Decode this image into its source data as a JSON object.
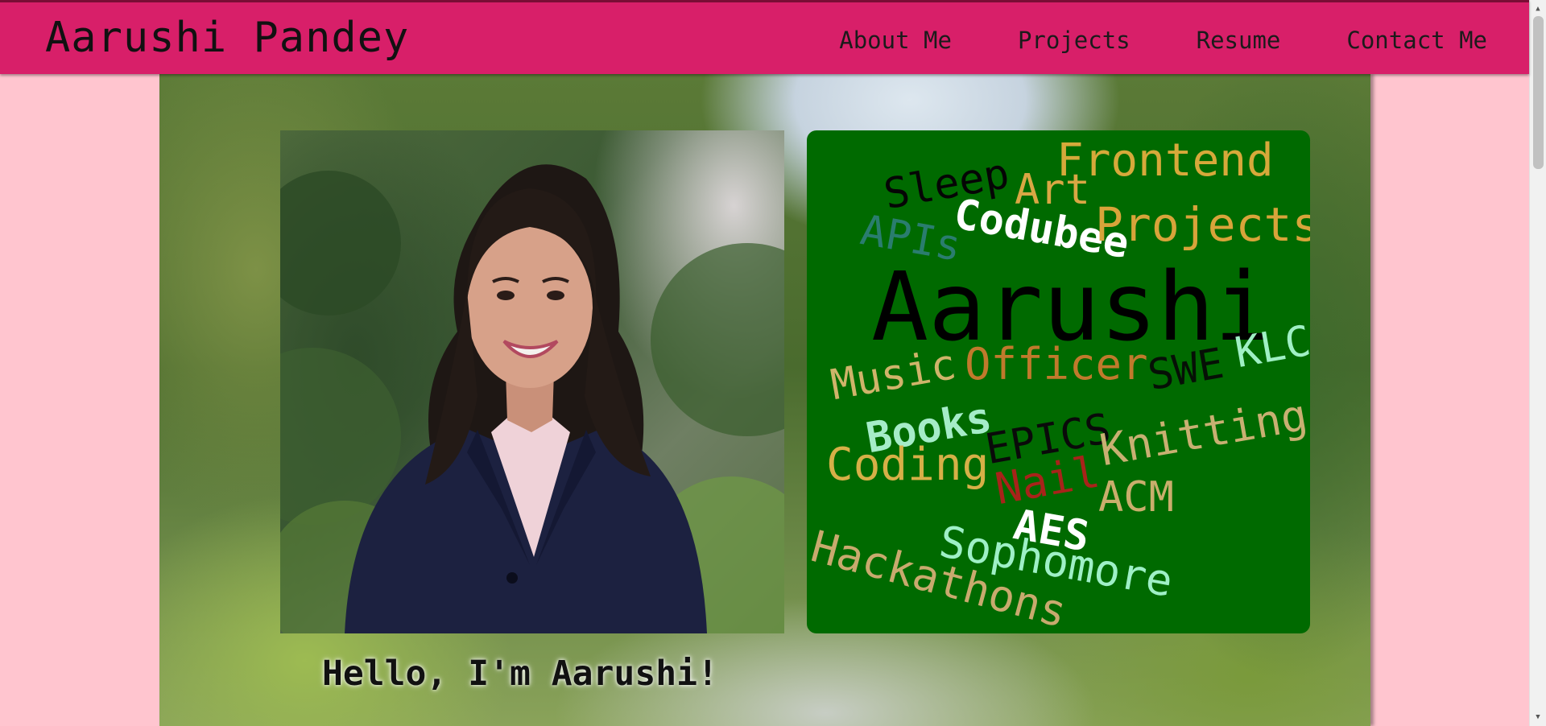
{
  "header": {
    "brand": "Aarushi Pandey",
    "nav": [
      "About Me",
      "Projects",
      "Resume",
      "Contact Me"
    ]
  },
  "hero": {
    "greeting": "Hello, I'm Aarushi!"
  },
  "wordcloud": {
    "words": [
      {
        "text": "Frontend",
        "color": "#d6a93a"
      },
      {
        "text": "Sleep",
        "color": "#050505"
      },
      {
        "text": "Art",
        "color": "#d9a744"
      },
      {
        "text": "Codubee",
        "color": "#ffffff"
      },
      {
        "text": "Projects",
        "color": "#d8a43a"
      },
      {
        "text": "APIs",
        "color": "#2a7d6e"
      },
      {
        "text": "Aarushi",
        "color": "#000000"
      },
      {
        "text": "Music",
        "color": "#cfb46a"
      },
      {
        "text": "Officer",
        "color": "#c07a2c"
      },
      {
        "text": "SWE",
        "color": "#061006"
      },
      {
        "text": "KLC",
        "color": "#9ff0c4"
      },
      {
        "text": "Books",
        "color": "#a5ecc8"
      },
      {
        "text": "EPICS",
        "color": "#0a0a0a"
      },
      {
        "text": "Knitting",
        "color": "#c8b072"
      },
      {
        "text": "Coding",
        "color": "#d6b047"
      },
      {
        "text": "Nail",
        "color": "#a8231a"
      },
      {
        "text": "ACM",
        "color": "#c9ae6c"
      },
      {
        "text": "AES",
        "color": "#ffffff"
      },
      {
        "text": "Sophomore",
        "color": "#9ef0c6"
      },
      {
        "text": "Hackathons",
        "color": "#c8aa6e"
      }
    ]
  },
  "colors": {
    "header_bg": "#d81f69",
    "page_bg": "#ffc5cf",
    "wordcloud_bg": "#006a00"
  }
}
